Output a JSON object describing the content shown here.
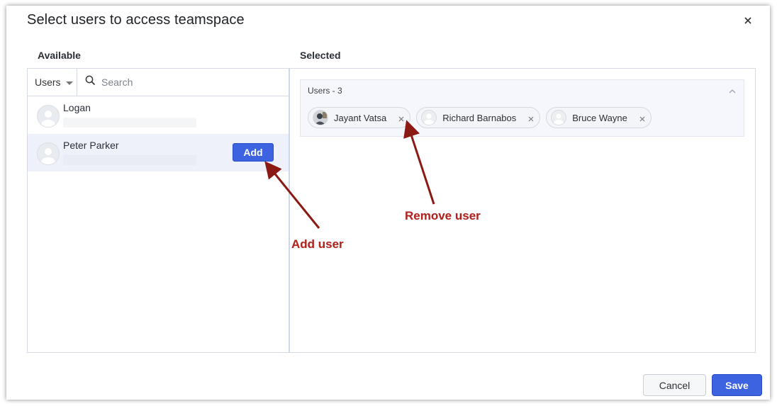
{
  "dialog": {
    "title": "Select users to access teamspace",
    "close_icon": "close-icon"
  },
  "available": {
    "label": "Available",
    "filter": {
      "selected": "Users"
    },
    "search": {
      "placeholder": "Search",
      "value": ""
    },
    "users": [
      {
        "name": "Logan"
      },
      {
        "name": "Peter Parker",
        "action_label": "Add"
      }
    ]
  },
  "selected": {
    "label": "Selected",
    "group_title": "Users - 3",
    "chips": [
      {
        "name": "Jayant Vatsa",
        "has_photo": true
      },
      {
        "name": "Richard Barnabos",
        "has_photo": false
      },
      {
        "name": "Bruce Wayne",
        "has_photo": false
      }
    ]
  },
  "footer": {
    "cancel_label": "Cancel",
    "save_label": "Save"
  },
  "annotations": {
    "add_user": "Add user",
    "remove_user": "Remove user"
  },
  "colors": {
    "primary": "#3d63e0",
    "annotation": "#b3231d",
    "arrow": "#8b1a15"
  }
}
